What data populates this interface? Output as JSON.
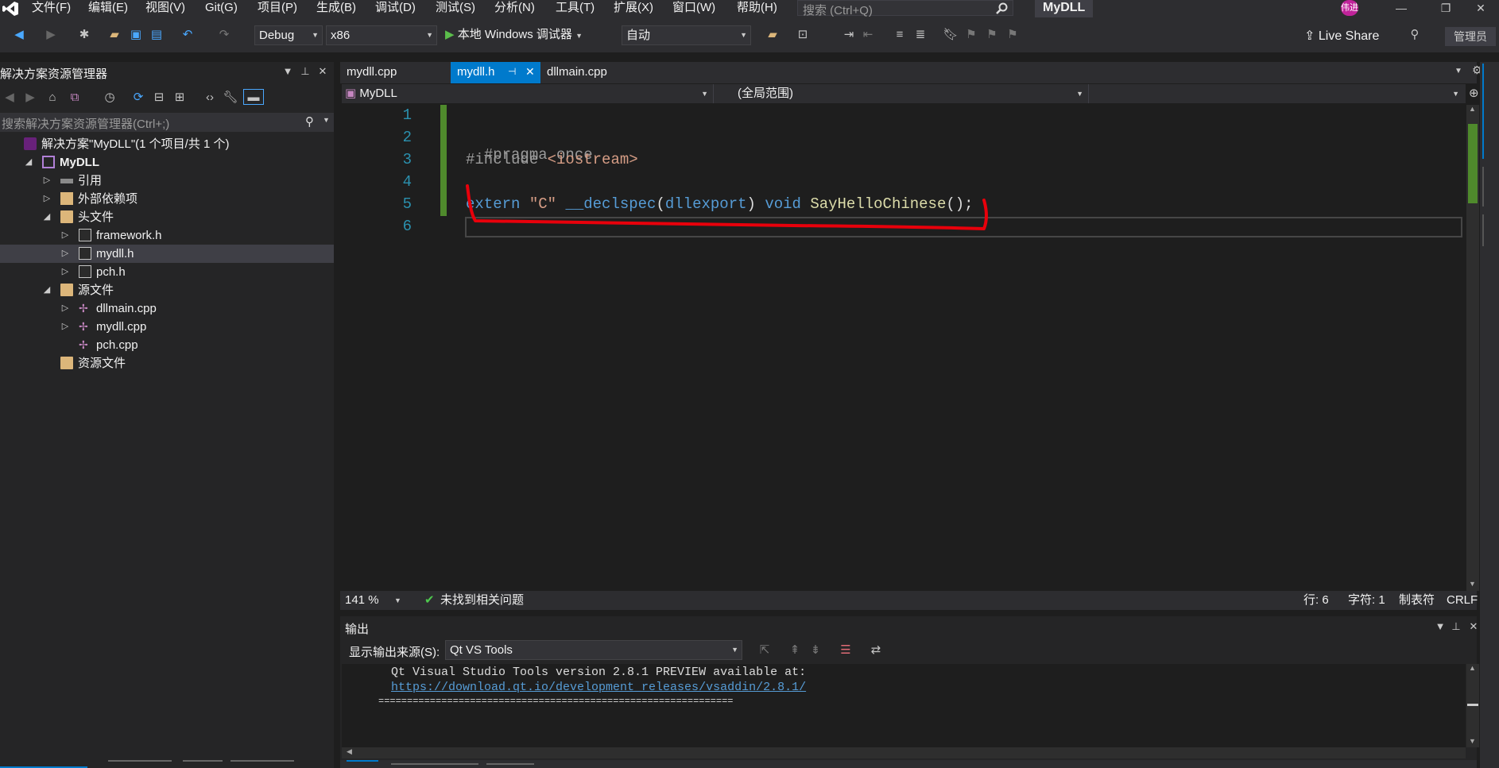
{
  "menu": {
    "items": [
      "文件(F)",
      "编辑(E)",
      "视图(V)",
      "Git(G)",
      "项目(P)",
      "生成(B)",
      "调试(D)",
      "测试(S)",
      "分析(N)",
      "工具(T)",
      "扩展(X)",
      "窗口(W)",
      "帮助(H)"
    ],
    "search_placeholder": "搜索 (Ctrl+Q)",
    "solution_title": "MyDLL",
    "avatar_initials": "伟进"
  },
  "toolbar": {
    "config": "Debug",
    "platform": "x86",
    "debugger_label": "本地 Windows 调试器",
    "mode": "自动",
    "live_share": "Live Share",
    "admin": "管理员"
  },
  "solution_explorer": {
    "title": "解决方案资源管理器",
    "search_placeholder": "搜索解决方案资源管理器(Ctrl+;)",
    "tree": [
      {
        "label": "解决方案\"MyDLL\"(1 个项目/共 1 个)",
        "icon": "solution-icon",
        "level": 0,
        "arrow": ""
      },
      {
        "label": "MyDLL",
        "icon": "project-icon",
        "level": 1,
        "arrow": "expanded",
        "bold": true
      },
      {
        "label": "引用",
        "icon": "references-icon",
        "level": 2,
        "arrow": "collapsed"
      },
      {
        "label": "外部依赖项",
        "icon": "external-deps-icon",
        "level": 2,
        "arrow": "collapsed"
      },
      {
        "label": "头文件",
        "icon": "folder-icon",
        "level": 2,
        "arrow": "expanded"
      },
      {
        "label": "framework.h",
        "icon": "header-file-icon",
        "level": 3,
        "arrow": "collapsed"
      },
      {
        "label": "mydll.h",
        "icon": "header-file-icon",
        "level": 3,
        "arrow": "collapsed",
        "selected": true
      },
      {
        "label": "pch.h",
        "icon": "header-file-icon",
        "level": 3,
        "arrow": "collapsed"
      },
      {
        "label": "源文件",
        "icon": "folder-icon",
        "level": 2,
        "arrow": "expanded"
      },
      {
        "label": "dllmain.cpp",
        "icon": "cpp-file-icon",
        "level": 3,
        "arrow": "collapsed"
      },
      {
        "label": "mydll.cpp",
        "icon": "cpp-file-icon",
        "level": 3,
        "arrow": "collapsed"
      },
      {
        "label": "pch.cpp",
        "icon": "cpp-file-icon",
        "level": 3,
        "arrow": ""
      },
      {
        "label": "资源文件",
        "icon": "folder-icon",
        "level": 2,
        "arrow": ""
      }
    ]
  },
  "editor": {
    "tabs": [
      {
        "label": "mydll.cpp",
        "active": false
      },
      {
        "label": "mydll.h",
        "active": true
      },
      {
        "label": "dllmain.cpp",
        "active": false
      }
    ],
    "nav_project": "MyDLL",
    "nav_scope": "(全局范围)",
    "line_numbers": [
      "1",
      "2",
      "3",
      "4",
      "5",
      "6"
    ],
    "code": {
      "l2": "#pragma once",
      "l3_directive": "#include ",
      "l3_header": "<iostream>",
      "l5_extern": "extern ",
      "l5_linkage": "\"C\" ",
      "l5_declspec": "__declspec",
      "l5_paren_open": "(",
      "l5_dllexport": "dllexport",
      "l5_paren_close": ") ",
      "l5_void": "void ",
      "l5_fn": "SayHelloChinese",
      "l5_tail": "();"
    }
  },
  "status": {
    "zoom": "141 %",
    "issues": "未找到相关问题",
    "row": "行: 6",
    "col": "字符: 1",
    "indent": "制表符",
    "eol": "CRLF"
  },
  "output": {
    "title": "输出",
    "source_label": "显示输出来源(S):",
    "source_value": "Qt VS Tools",
    "lines": [
      "Qt Visual Studio Tools version 2.8.1 PREVIEW available at:",
      "https://download.qt.io/development_releases/vsaddin/2.8.1/",
      "=============================================================="
    ]
  },
  "colors": {
    "accent": "#007acc",
    "annotation": "#e8000b",
    "change_bar": "#4f8a2c"
  }
}
